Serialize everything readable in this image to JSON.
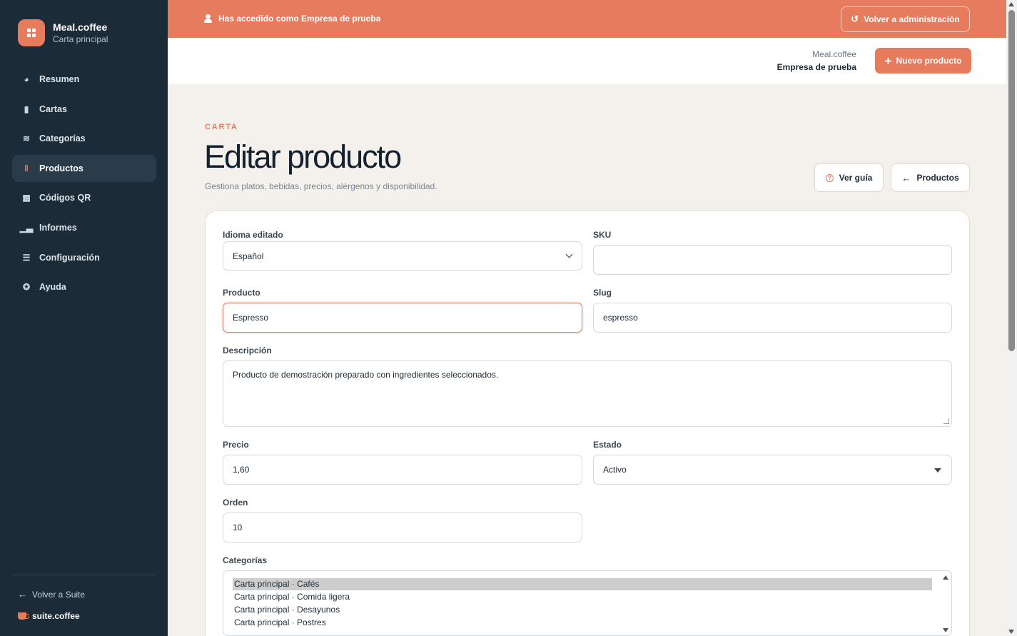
{
  "brand": {
    "name": "Meal.coffee",
    "subtitle": "Carta principal"
  },
  "sidebar": {
    "items": [
      {
        "label": "Resumen",
        "icon": "pie-chart-icon",
        "glyph": "◕"
      },
      {
        "label": "Cartas",
        "icon": "book-icon",
        "glyph": "▮▮"
      },
      {
        "label": "Categorías",
        "icon": "layers-icon",
        "glyph": "≋"
      },
      {
        "label": "Productos",
        "icon": "utensils-icon",
        "glyph": "🍴",
        "active": true
      },
      {
        "label": "Códigos QR",
        "icon": "qr-code-icon",
        "glyph": "▦"
      },
      {
        "label": "Informes",
        "icon": "bar-chart-icon",
        "glyph": "▂▄"
      },
      {
        "label": "Configuración",
        "icon": "sliders-icon",
        "glyph": "☰"
      },
      {
        "label": "Ayuda",
        "icon": "help-circle-icon",
        "glyph": "✪"
      }
    ],
    "back_label": "Volver a Suite",
    "suite_brand": "suite.coffee"
  },
  "banner": {
    "message": "Has accedido como Empresa de prueba",
    "back_admin_label": "Volver a administración"
  },
  "header": {
    "app_name": "Meal.coffee",
    "company_name": "Empresa de prueba",
    "new_product_label": "Nuevo producto"
  },
  "page": {
    "eyebrow": "CARTA",
    "title": "Editar producto",
    "subtitle": "Gestiona platos, bebidas, precios, alérgenos y disponibilidad.",
    "guide_label": "Ver guía",
    "products_label": "Productos"
  },
  "form": {
    "language": {
      "label": "Idioma editado",
      "value": "Español"
    },
    "sku": {
      "label": "SKU",
      "value": ""
    },
    "product": {
      "label": "Producto",
      "value": "Espresso"
    },
    "slug": {
      "label": "Slug",
      "value": "espresso"
    },
    "description": {
      "label": "Descripción",
      "value": "Producto de demostración preparado con ingredientes seleccionados."
    },
    "price": {
      "label": "Precio",
      "value": "1,60"
    },
    "status": {
      "label": "Estado",
      "value": "Activo"
    },
    "order": {
      "label": "Orden",
      "value": "10"
    },
    "categories": {
      "label": "Categorías",
      "options": [
        "Carta principal · Cafés",
        "Carta principal · Comida ligera",
        "Carta principal · Desayunos",
        "Carta principal · Postres"
      ],
      "selected_index": 0
    }
  },
  "colors": {
    "accent": "#e77b5e",
    "sidebar": "#1c2b38",
    "background": "#f4f1ec"
  }
}
